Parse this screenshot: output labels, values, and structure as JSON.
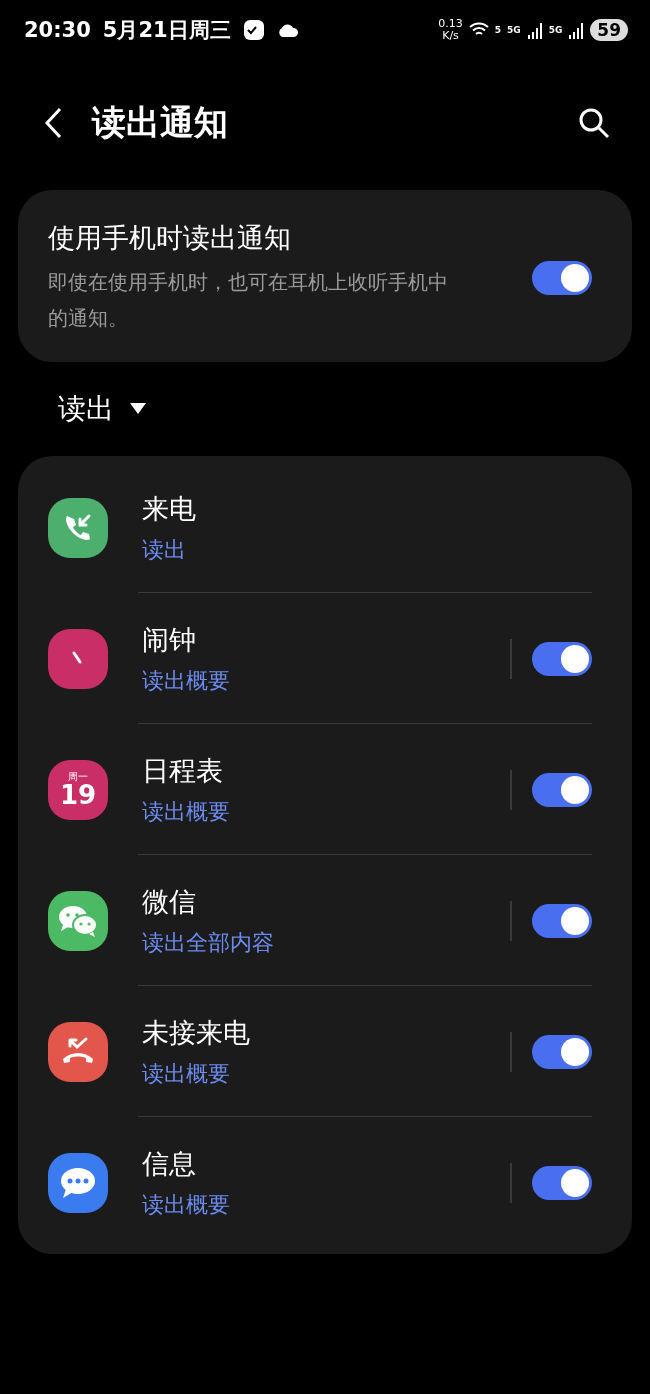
{
  "status_bar": {
    "time": "20:30",
    "date": "5月21日周三",
    "speed": "0.13",
    "speed_unit": "K/s",
    "wifi_badge": "5",
    "sim_1": "5G",
    "sim_2": "5G",
    "battery": "59"
  },
  "header": {
    "title": "读出通知"
  },
  "main_setting": {
    "title": "使用手机时读出通知",
    "description": "即使在使用手机时，也可在耳机上收听手机中的通知。",
    "on": true
  },
  "filter": {
    "label": "读出"
  },
  "apps": [
    {
      "name": "来电",
      "mode": "读出",
      "kind": "plain",
      "color": "#4caf6e"
    },
    {
      "name": "闹钟",
      "mode": "读出概要",
      "kind": "switch",
      "on": true,
      "color": "#c92e66"
    },
    {
      "name": "日程表",
      "mode": "读出概要",
      "kind": "switch",
      "on": true,
      "color": "#c92e66",
      "icon_day": "周一",
      "icon_date": "19"
    },
    {
      "name": "微信",
      "mode": "读出全部内容",
      "kind": "switch",
      "on": true,
      "color": "#4cba64"
    },
    {
      "name": "未接来电",
      "mode": "读出概要",
      "kind": "switch",
      "on": true,
      "color": "#e2564b"
    },
    {
      "name": "信息",
      "mode": "读出概要",
      "kind": "switch",
      "on": true,
      "color": "#3a7cf0"
    }
  ]
}
